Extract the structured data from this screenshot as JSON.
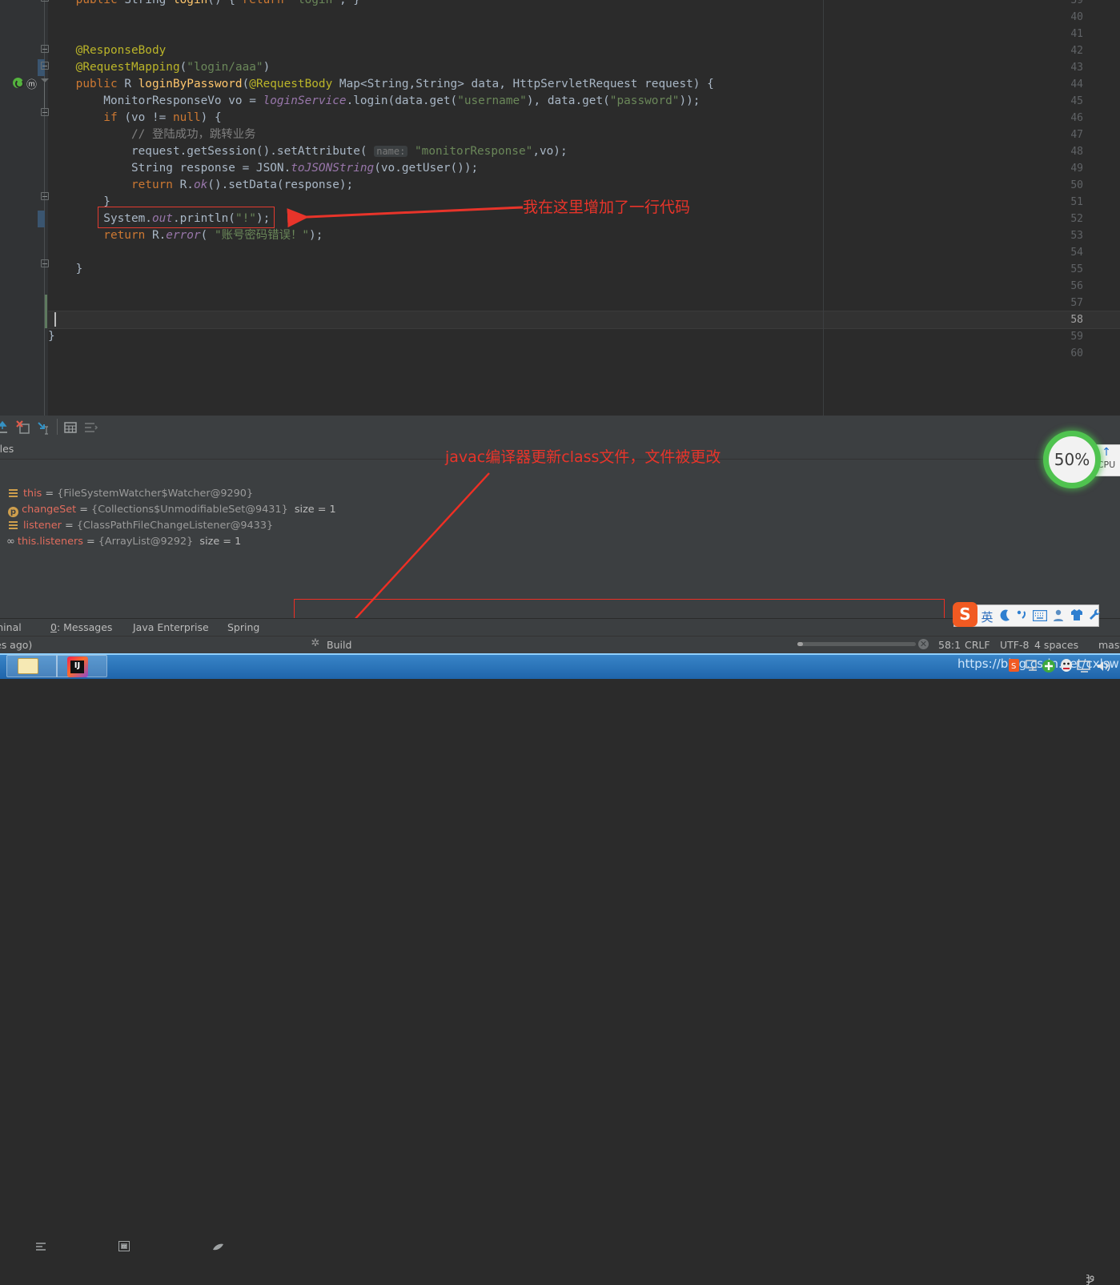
{
  "editor": {
    "first_visible_line": 39,
    "last_visible_line": 60,
    "current_line": 58,
    "lines": [
      {
        "n": 39,
        "text": "    public String login() { return \"login\"; }"
      },
      {
        "n": 40,
        "text": ""
      },
      {
        "n": 41,
        "text": ""
      },
      {
        "n": 42,
        "text": "    @ResponseBody"
      },
      {
        "n": 43,
        "text": "    @RequestMapping(\"login/aaa\")"
      },
      {
        "n": 44,
        "text": "    public R loginByPassword(@RequestBody Map<String,String> data, HttpServletRequest request) {"
      },
      {
        "n": 45,
        "text": "        MonitorResponseVo vo = loginService.login(data.get(\"username\"), data.get(\"password\"));"
      },
      {
        "n": 46,
        "text": "        if (vo != null) {"
      },
      {
        "n": 47,
        "text": "            // 登陆成功，跳转业务"
      },
      {
        "n": 48,
        "text": "            request.getSession().setAttribute( name: \"monitorResponse\",vo);"
      },
      {
        "n": 49,
        "text": "            String response = JSON.toJSONString(vo.getUser());"
      },
      {
        "n": 50,
        "text": "            return R.ok().setData(response);"
      },
      {
        "n": 51,
        "text": "        }"
      },
      {
        "n": 52,
        "text": "        System.out.println(\"!\");"
      },
      {
        "n": 53,
        "text": "        return R.error( \"账号密码错误！\");"
      },
      {
        "n": 54,
        "text": ""
      },
      {
        "n": 55,
        "text": "    }"
      },
      {
        "n": 56,
        "text": ""
      },
      {
        "n": 57,
        "text": ""
      },
      {
        "n": 58,
        "text": ""
      },
      {
        "n": 59,
        "text": "}"
      },
      {
        "n": 60,
        "text": ""
      }
    ],
    "parameter_hint": "name:"
  },
  "annotations": {
    "code_note": "我在这里增加了一行代码",
    "build_note": "javac编译器更新class文件，文件被更改",
    "highlight_color": "#e8342a"
  },
  "debugger": {
    "panel_title": "ables",
    "variables": [
      {
        "icon": "field-icon",
        "name": "this",
        "value": "{FileSystemWatcher$Watcher@9290}",
        "size": ""
      },
      {
        "icon": "param-icon",
        "name": "changeSet",
        "value": "{Collections$UnmodifiableSet@9431}",
        "size": "size = 1"
      },
      {
        "icon": "field-icon",
        "name": "listener",
        "value": "{ClassPathFileChangeListener@9433}",
        "size": ""
      },
      {
        "icon": "watch-icon",
        "name": "this.listeners",
        "value": "{ArrayList@9292}",
        "size": "size = 1"
      }
    ],
    "toolbar": [
      {
        "name": "step-out-icon"
      },
      {
        "name": "force-step-into-icon"
      },
      {
        "name": "run-to-cursor-icon"
      },
      {
        "name": "evaluate-expression-icon"
      },
      {
        "name": "sort-values-icon"
      }
    ]
  },
  "cpu_widget": {
    "percent": "50%",
    "tooltip_label": "CPU",
    "tooltip_arrow": "↑",
    "ring_color": "#4fc34f"
  },
  "toolwindow_bar": {
    "items": [
      {
        "label": "minal",
        "name": "tool-window-terminal"
      },
      {
        "label": "0: Messages",
        "name": "tool-window-messages",
        "underline_index": 0
      },
      {
        "label": "Java Enterprise",
        "name": "tool-window-java-enterprise"
      },
      {
        "label": "Spring",
        "name": "tool-window-spring"
      }
    ]
  },
  "status_bar": {
    "left_text": "es ago)",
    "build_label": "Build",
    "caret_position": "58:1",
    "line_separator": "CRLF",
    "encoding": "UTF-8",
    "indent": "4 spaces",
    "branch": "mast",
    "progress_percent": 5
  },
  "ime": {
    "logo": "S",
    "mode": "英",
    "icons": [
      "moon-icon",
      "comma-icon",
      "keyboard-icon",
      "person-icon",
      "shirt-icon",
      "wrench-icon"
    ]
  },
  "taskbar": {
    "watermark": "https://blog.csdn.net/cxlswb",
    "buttons": [
      {
        "name": "taskbar-explorer",
        "icon": "folder-icon"
      },
      {
        "name": "taskbar-intellij",
        "icon": "intellij-idea-icon",
        "label": "IJ"
      }
    ]
  }
}
